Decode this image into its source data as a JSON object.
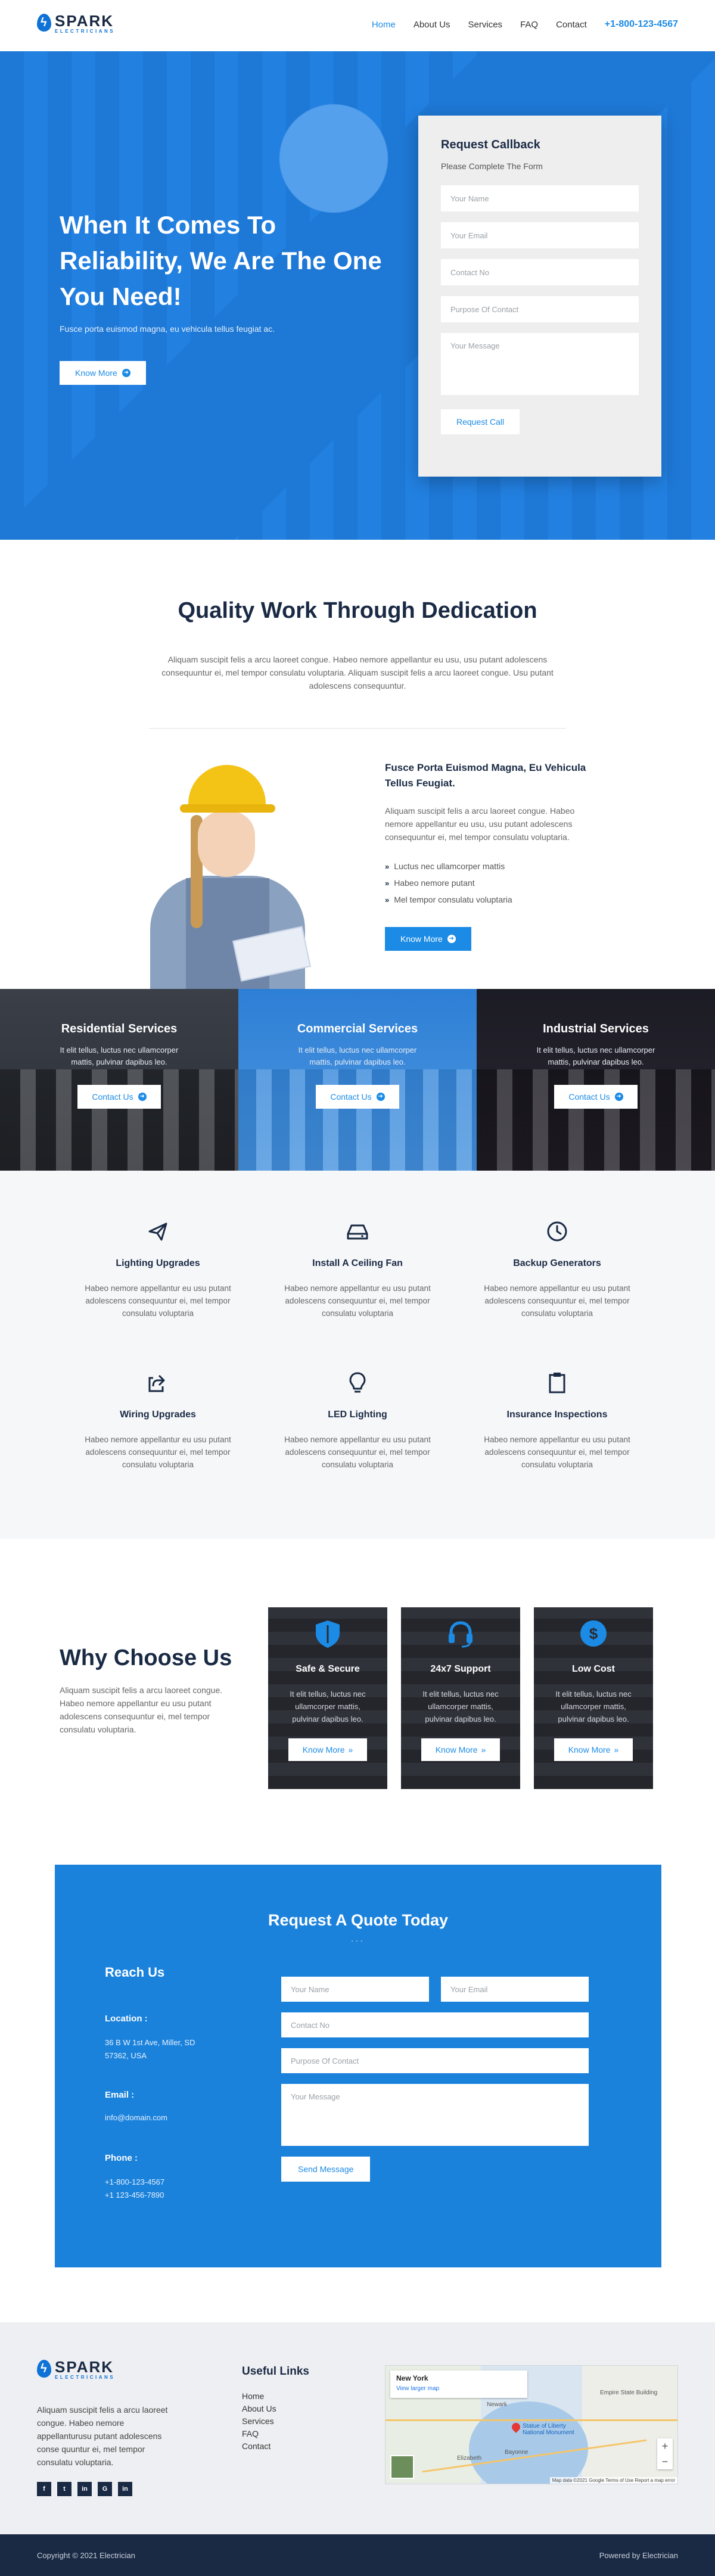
{
  "brand": {
    "name": "SPARK",
    "tagline": "ELECTRICIANS",
    "accent": "#1b8be5",
    "dark": "#1a2a44"
  },
  "nav": {
    "items": [
      {
        "label": "Home",
        "active": true
      },
      {
        "label": "About Us"
      },
      {
        "label": "Services"
      },
      {
        "label": "FAQ"
      },
      {
        "label": "Contact"
      }
    ],
    "phone": "+1-800-123-4567"
  },
  "hero": {
    "title": "When It Comes To Reliability, We Are The One You Need!",
    "subtitle": "Fusce porta euismod magna, eu vehicula tellus feugiat ac.",
    "button": "Know More"
  },
  "callback": {
    "title": "Request Callback",
    "subtitle": "Please Complete The Form",
    "fields": {
      "name": "Your Name",
      "email": "Your Email",
      "contact": "Contact No",
      "purpose": "Purpose Of Contact",
      "message": "Your Message"
    },
    "button": "Request Call"
  },
  "quality": {
    "title": "Quality Work Through Dedication",
    "text": "Aliquam suscipit felis a arcu laoreet congue. Habeo nemore appellantur eu usu, usu putant adolescens consequuntur ei, mel tempor consulatu voluptaria. Aliquam suscipit felis a arcu laoreet congue. Usu putant adolescens consequuntur.",
    "heading": "Fusce Porta Euismod Magna, Eu Vehicula Tellus Feugiat.",
    "para": "Aliquam suscipit felis a arcu laoreet congue. Habeo nemore appellantur eu usu, usu putant adolescens consequuntur ei, mel tempor consulatu voluptaria.",
    "bullets": [
      "Luctus nec ullamcorper mattis",
      "Habeo nemore putant",
      "Mel tempor consulatu voluptaria"
    ],
    "button": "Know More"
  },
  "banners": [
    {
      "title": "Residential Services",
      "text": "It elit tellus, luctus nec ullamcorper mattis, pulvinar dapibus leo.",
      "button": "Contact Us"
    },
    {
      "title": "Commercial Services",
      "text": "It elit tellus, luctus nec ullamcorper mattis, pulvinar dapibus leo.",
      "button": "Contact Us"
    },
    {
      "title": "Industrial Services",
      "text": "It elit tellus, luctus nec ullamcorper mattis, pulvinar dapibus leo.",
      "button": "Contact Us"
    }
  ],
  "features": [
    {
      "title": "Lighting Upgrades",
      "icon": "paper-plane-icon",
      "text": "Habeo nemore appellantur eu usu putant adolescens consequuntur ei, mel tempor consulatu voluptaria"
    },
    {
      "title": "Install A Ceiling Fan",
      "icon": "hdd-icon",
      "text": "Habeo nemore appellantur eu usu putant adolescens consequuntur ei, mel tempor consulatu voluptaria"
    },
    {
      "title": "Backup Generators",
      "icon": "clock-icon",
      "text": "Habeo nemore appellantur eu usu putant adolescens consequuntur ei, mel tempor consulatu voluptaria"
    },
    {
      "title": "Wiring Upgrades",
      "icon": "share-icon",
      "text": "Habeo nemore appellantur eu usu putant adolescens consequuntur ei, mel tempor consulatu voluptaria"
    },
    {
      "title": "LED Lighting",
      "icon": "lightbulb-icon",
      "text": "Habeo nemore appellantur eu usu putant adolescens consequuntur ei, mel tempor consulatu voluptaria"
    },
    {
      "title": "Insurance Inspections",
      "icon": "clipboard-icon",
      "text": "Habeo nemore appellantur eu usu putant adolescens consequuntur ei, mel tempor consulatu voluptaria"
    }
  ],
  "why": {
    "title": "Why Choose Us",
    "text": "Aliquam suscipit felis a arcu laoreet congue. Habeo nemore appellantur eu usu putant adolescens consequuntur ei, mel tempor consulatu voluptaria.",
    "cards": [
      {
        "title": "Safe & Secure",
        "icon": "shield-icon",
        "text": "It elit tellus, luctus nec ullamcorper mattis, pulvinar dapibus leo.",
        "button": "Know More"
      },
      {
        "title": "24x7 Support",
        "icon": "headset-icon",
        "text": "It elit tellus, luctus nec ullamcorper mattis, pulvinar dapibus leo.",
        "button": "Know More"
      },
      {
        "title": "Low Cost",
        "icon": "dollar-icon",
        "text": "It elit tellus, luctus nec ullamcorper mattis, pulvinar dapibus leo.",
        "button": "Know More"
      }
    ]
  },
  "quote": {
    "title": "Request A Quote Today",
    "dots": "...",
    "reach": "Reach Us",
    "location_label": "Location :",
    "location": "36 B W 1st Ave, Miller, SD 57362, USA",
    "email_label": "Email :",
    "email": "info@domain.com",
    "phone_label": "Phone :",
    "phone1": "+1-800-123-4567",
    "phone2": "+1 123-456-7890",
    "fields": {
      "name": "Your Name",
      "email": "Your Email",
      "contact": "Contact No",
      "purpose": "Purpose Of Contact",
      "message": "Your Message"
    },
    "button": "Send Message"
  },
  "footer": {
    "about": "Aliquam suscipit felis a arcu laoreet congue. Habeo nemore appellanturusu putant adolescens conse quuntur ei, mel tempor consulatu voluptaria.",
    "socials": [
      "f",
      "t",
      "in",
      "G",
      "in"
    ],
    "useful_title": "Useful Links",
    "links": [
      "Home",
      "About Us",
      "Services",
      "FAQ",
      "Contact"
    ],
    "map": {
      "place": "New York",
      "view_link": "View larger map",
      "labels": [
        "Newark",
        "Statue of Liberty National Monument",
        "Empire State Building",
        "Elizabeth",
        "Bayonne"
      ],
      "attribution": "Map data ©2021 Google  Terms of Use  Report a map error",
      "zoom_in": "+",
      "zoom_out": "−"
    },
    "copyright": "Copyright © 2021 Electrician",
    "powered": "Powered by Electrician"
  }
}
